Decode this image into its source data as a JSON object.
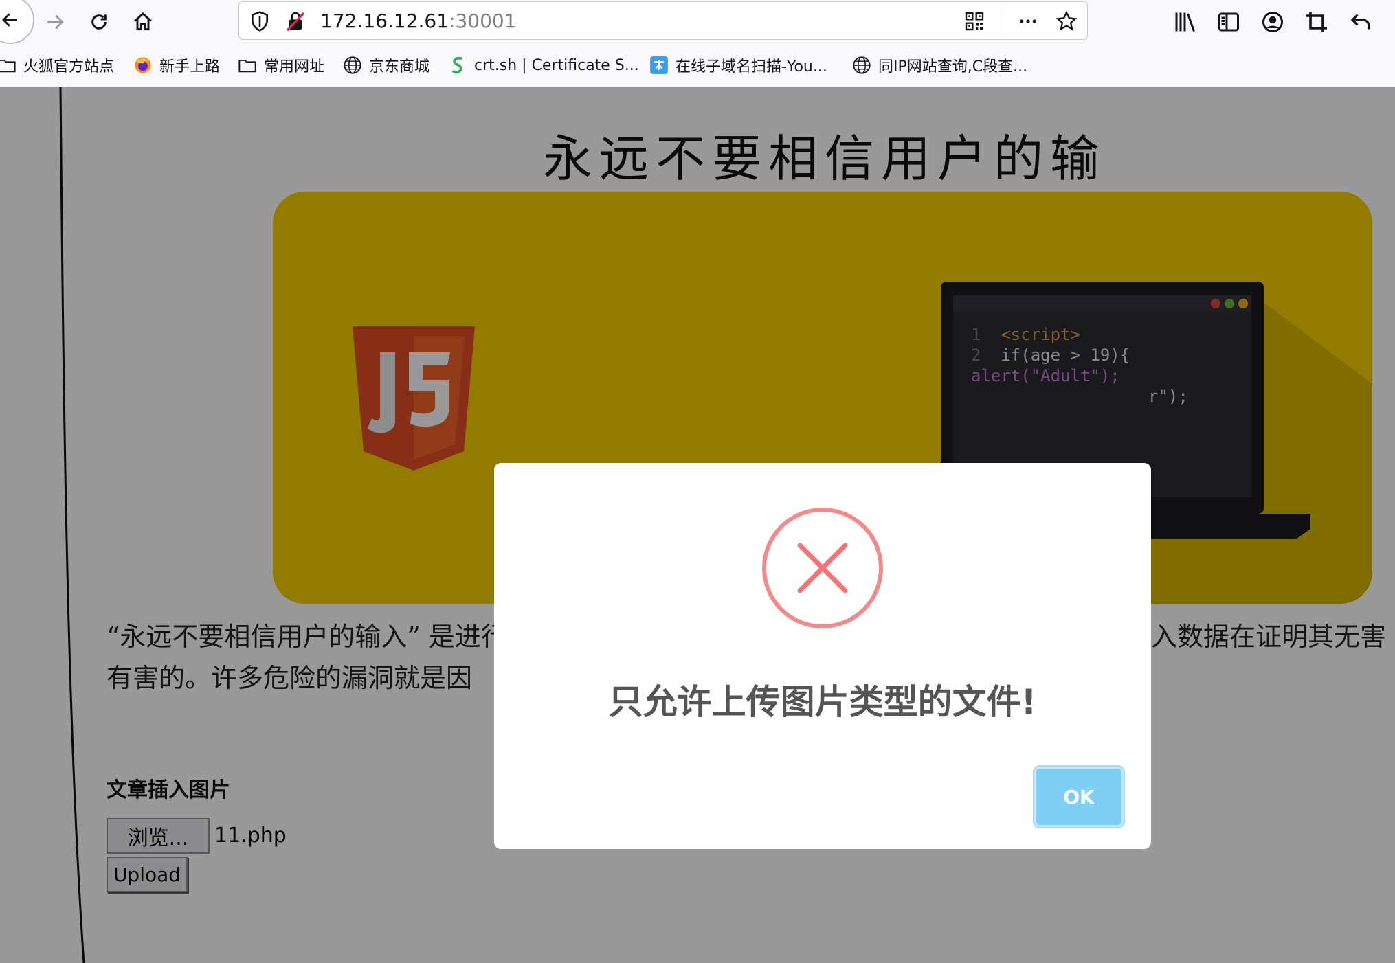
{
  "browser": {
    "url_host": "172.16.12.61",
    "url_port": ":30001",
    "bookmarks": [
      {
        "label": "火狐官方站点",
        "icon": "folder-icon"
      },
      {
        "label": "新手上路",
        "icon": "firefox-icon"
      },
      {
        "label": "常用网址",
        "icon": "folder-icon"
      },
      {
        "label": "京东商城",
        "icon": "globe-icon"
      },
      {
        "label": "crt.sh | Certificate S...",
        "icon": "crtsh-icon"
      },
      {
        "label": "在线子域名扫描-You...",
        "icon": "subdomain-icon"
      },
      {
        "label": "同IP网站查询,C段查...",
        "icon": "globe-icon"
      }
    ]
  },
  "page": {
    "title": "永远不要相信用户的输入",
    "banner": {
      "code_lines": [
        {
          "n": "1",
          "text": "<script>"
        },
        {
          "n": "2",
          "text": "if(age > 19){"
        }
      ],
      "code_fragment_1": "alert(\"Adult\");",
      "code_fragment_2": "r\");"
    },
    "intro_line1_left": "“永远不要相信用户的输入” 是进行",
    "intro_line1_right": "入数据在证明其无害",
    "intro_line2": "有害的。许多危险的漏洞就是因",
    "section_title": "文章插入图片",
    "browse_label": "浏览...",
    "file_name": "11.php",
    "upload_label": "Upload"
  },
  "modal": {
    "icon": "error-x-icon",
    "message": "只允许上传图片类型的文件!",
    "ok_label": "OK",
    "colors": {
      "error": "#f27474",
      "ok_button": "#7ecff4"
    }
  },
  "colors": {
    "banner": "#f5cd00",
    "js_orange": "#e44d26"
  }
}
